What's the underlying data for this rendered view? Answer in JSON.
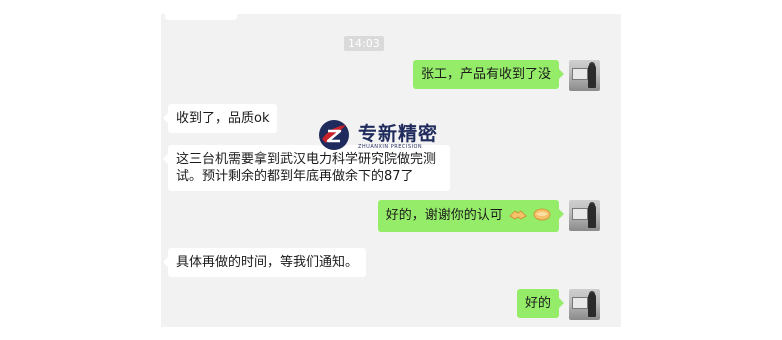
{
  "chat": {
    "timestamp": "14:03",
    "messages": [
      {
        "side": "out",
        "text": "张工，产品有收到了没"
      },
      {
        "side": "in",
        "text": "收到了，品质ok"
      },
      {
        "side": "in",
        "line1": "这三台机需要拿到武汉电力科学研究院做完测",
        "line2": "试。预计剩余的都到年底再做余下的87了"
      },
      {
        "side": "out",
        "text": "好的，谢谢你的认可",
        "emoji": "handshake-icon"
      },
      {
        "side": "in",
        "text": "具体再做的时间，等我们通知。"
      },
      {
        "side": "out",
        "text": "好的"
      }
    ]
  },
  "watermark": {
    "title": "专新精密",
    "subtitle": "ZHUANXIN PRECISION",
    "colors": {
      "red": "#c8222a",
      "navy": "#1f2b5c"
    }
  },
  "colors": {
    "outgoing_bubble": "#95ec69",
    "incoming_bubble": "#ffffff",
    "chat_background": "#f2f2f2"
  }
}
